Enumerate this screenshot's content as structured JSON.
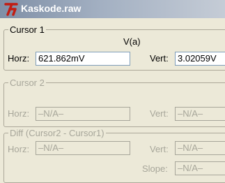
{
  "window": {
    "title": "Kaskode.raw",
    "icon": "ltspice-waveform-icon"
  },
  "cursor1": {
    "legend": "Cursor 1",
    "trace": "V(a)",
    "horz_label": "Horz:",
    "horz_value": "621.862mV",
    "vert_label": "Vert:",
    "vert_value": "3.02059V"
  },
  "cursor2": {
    "legend": "Cursor 2",
    "horz_label": "Horz:",
    "horz_value": "–N/A–",
    "vert_label": "Vert:",
    "vert_value": "–N/A–"
  },
  "diff": {
    "legend": "Diff (Cursor2 - Cursor1)",
    "horz_label": "Horz:",
    "horz_value": "–N/A–",
    "vert_label": "Vert:",
    "vert_value": "–N/A–",
    "slope_label": "Slope:",
    "slope_value": "–N/A–"
  }
}
